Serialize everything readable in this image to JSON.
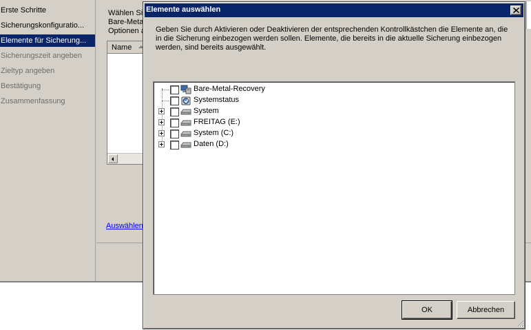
{
  "wizard": {
    "nav": [
      {
        "label": "Erste Schritte",
        "state": "done"
      },
      {
        "label": "Sicherungskonfiguratio...",
        "state": "done"
      },
      {
        "label": "Elemente für Sicherung...",
        "state": "active"
      },
      {
        "label": "Sicherungszeit angeben",
        "state": "disabled"
      },
      {
        "label": "Zieltyp angeben",
        "state": "disabled"
      },
      {
        "label": "Bestätigung",
        "state": "disabled"
      },
      {
        "label": "Zusammenfassung",
        "state": "disabled"
      }
    ],
    "intro_lines": [
      "Wählen Sie",
      "Bare-Meta",
      "Optionen a"
    ],
    "list_header": "Name",
    "link_text": "Auswählen"
  },
  "dialog": {
    "title": "Elemente auswählen",
    "description": "Geben Sie durch Aktivieren oder Deaktivieren der entsprechenden Kontrollkästchen die Elemente an, die in die Sicherung einbezogen werden sollen. Elemente, die bereits in die aktuelle Sicherung einbezogen werden, sind bereits ausgewählt.",
    "tree": [
      {
        "label": "Bare-Metal-Recovery",
        "icon": "bare-metal-icon",
        "expandable": false,
        "checked": false
      },
      {
        "label": "Systemstatus",
        "icon": "system-state-icon",
        "expandable": false,
        "checked": false
      },
      {
        "label": "System",
        "icon": "drive-icon",
        "expandable": true,
        "checked": false
      },
      {
        "label": "FREITAG (E:)",
        "icon": "drive-icon",
        "expandable": true,
        "checked": false
      },
      {
        "label": "System (C:)",
        "icon": "drive-icon",
        "expandable": true,
        "checked": false
      },
      {
        "label": "Daten (D:)",
        "icon": "drive-icon",
        "expandable": true,
        "checked": false
      }
    ],
    "ok_label": "OK",
    "cancel_label": "Abbrechen"
  },
  "colors": {
    "titlebar": "#0a246a",
    "face": "#d4d0c8",
    "selection": "#0a246a"
  }
}
